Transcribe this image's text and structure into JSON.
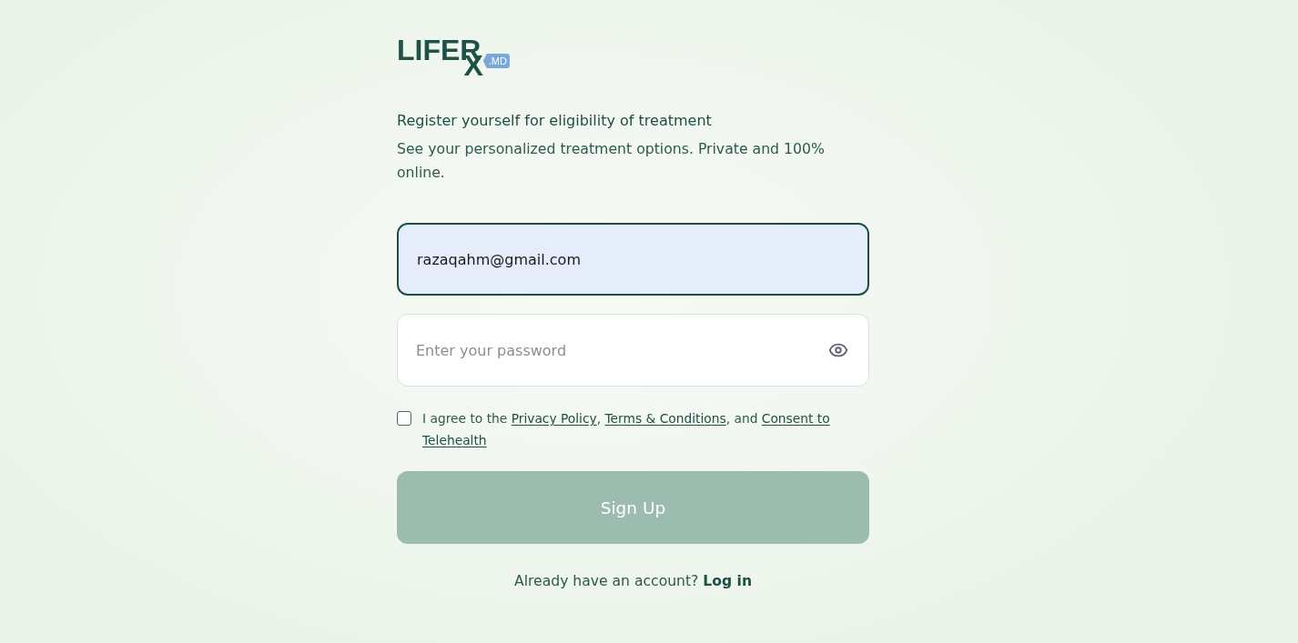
{
  "logo": {
    "wordmark": "LIFER",
    "mark": "X",
    "badge": ".MD"
  },
  "heading": "Register yourself for eligibility of treatment",
  "subtitle": "See your personalized treatment options. Private and 100% online.",
  "fields": [
    {
      "kind": "email",
      "value": "razaqahm@gmail.com",
      "focused": true
    },
    {
      "kind": "password",
      "placeholder": "Enter your password",
      "focused": false
    }
  ],
  "agreement": {
    "checked": false,
    "parts": [
      {
        "kind": "text",
        "text": "I agree to the "
      },
      {
        "kind": "link",
        "text": "Privacy Policy"
      },
      {
        "kind": "text",
        "text": ", "
      },
      {
        "kind": "link",
        "text": "Terms & Conditions"
      },
      {
        "kind": "text",
        "text": ", and "
      },
      {
        "kind": "link",
        "text": "Consent to"
      },
      {
        "kind": "link",
        "text": "Telehealth"
      }
    ]
  },
  "submit": {
    "label": "Sign Up",
    "disabled": true
  },
  "footer": {
    "parts": [
      {
        "kind": "text",
        "text": "Already have an account? "
      },
      {
        "kind": "link",
        "text": "Log in"
      }
    ]
  }
}
